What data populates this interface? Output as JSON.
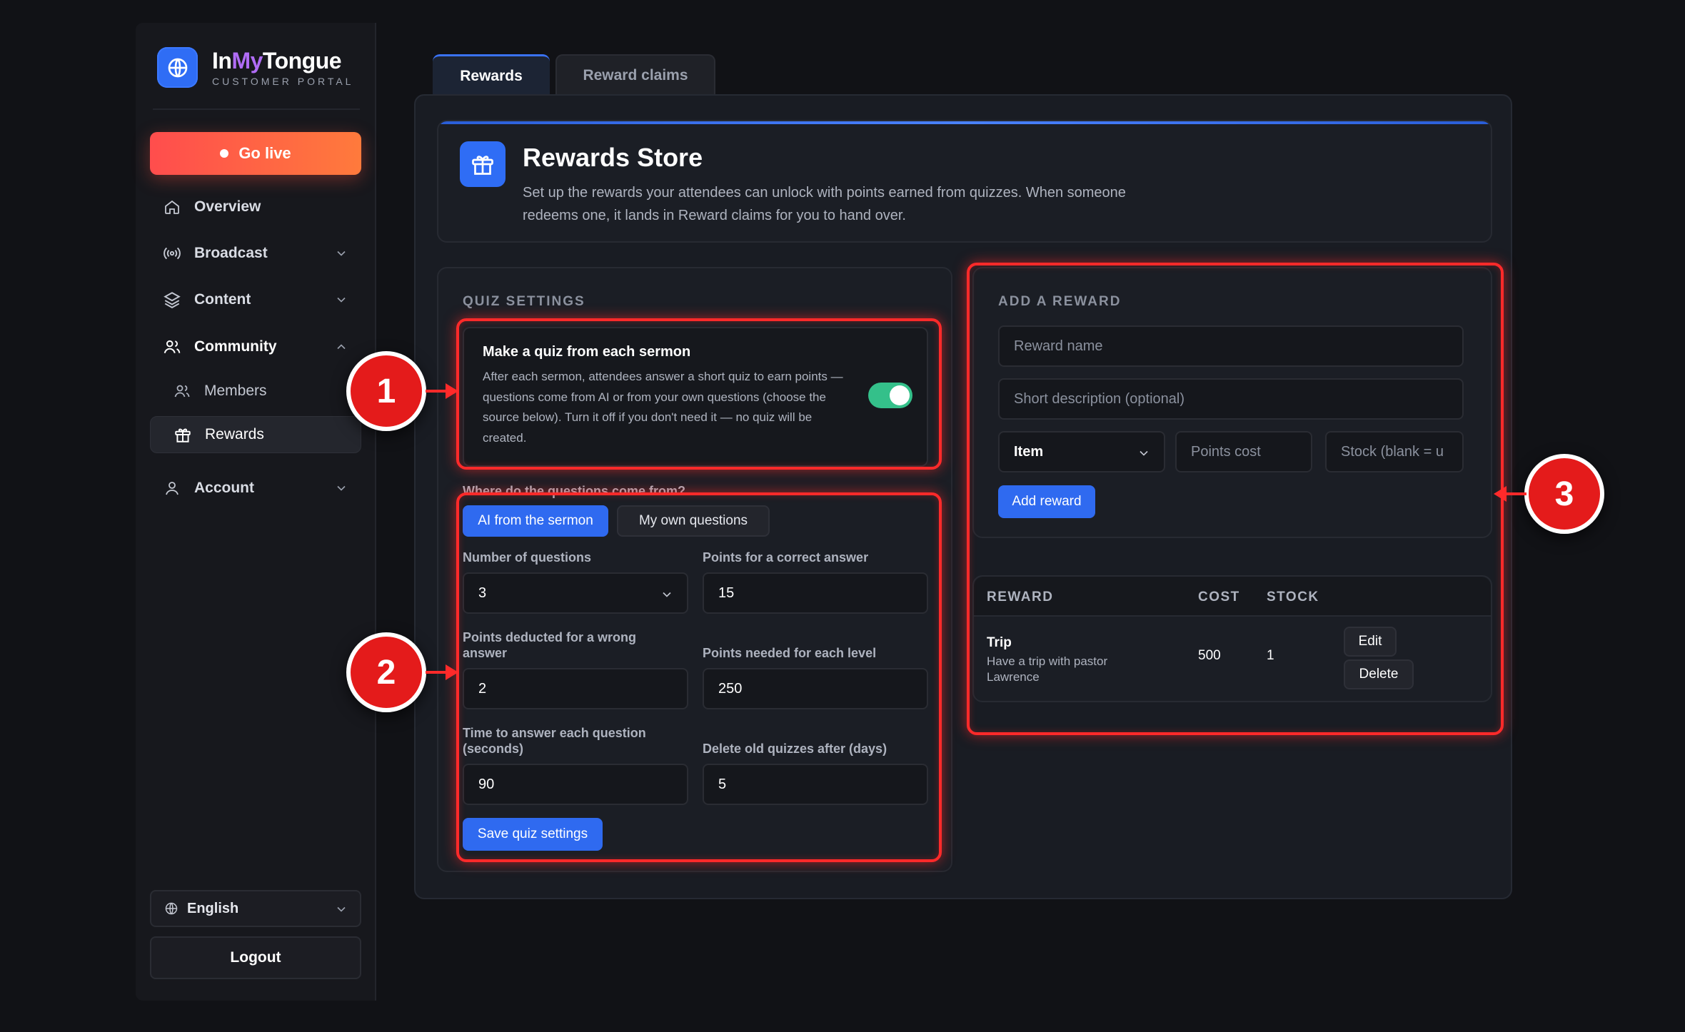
{
  "brand": {
    "name_part1": "In",
    "name_part2": "My",
    "name_part3": "Tongue",
    "subtitle": "CUSTOMER PORTAL",
    "logo_icon": "globe-icon"
  },
  "sidebar": {
    "go_live": "Go live",
    "items": [
      {
        "label": "Overview",
        "icon": "home-icon"
      },
      {
        "label": "Broadcast",
        "icon": "broadcast-icon",
        "chevron": "down"
      },
      {
        "label": "Content",
        "icon": "layers-icon",
        "chevron": "down"
      },
      {
        "label": "Community",
        "icon": "users-icon",
        "chevron": "up"
      },
      {
        "label": "Members",
        "icon": "users-icon",
        "sub": true
      },
      {
        "label": "Rewards",
        "icon": "gift-icon",
        "sub": true,
        "active": true
      },
      {
        "label": "Account",
        "icon": "user-icon",
        "chevron": "down"
      }
    ],
    "language": "English",
    "logout": "Logout"
  },
  "tabs": [
    {
      "label": "Rewards",
      "active": true
    },
    {
      "label": "Reward claims",
      "active": false
    }
  ],
  "header": {
    "title": "Rewards Store",
    "description": "Set up the rewards your attendees can unlock with points earned from quizzes. When someone redeems one, it lands in Reward claims for you to hand over."
  },
  "quiz": {
    "section_title": "QUIZ SETTINGS",
    "toggle_title": "Make a quiz from each sermon",
    "toggle_desc": "After each sermon, attendees answer a short quiz to earn points — questions come from AI or from your own questions (choose the source below). Turn it off if you don't need it — no quiz will be created.",
    "toggle_on": true,
    "source_label": "Where do the questions come from?",
    "source_options": [
      "AI from the sermon",
      "My own questions"
    ],
    "source_selected": "AI from the sermon",
    "fields": {
      "num_questions": {
        "label": "Number of questions",
        "value": "3"
      },
      "points_correct": {
        "label": "Points for a correct answer",
        "value": "15"
      },
      "points_wrong": {
        "label": "Points deducted for a wrong answer",
        "value": "2"
      },
      "points_level": {
        "label": "Points needed for each level",
        "value": "250"
      },
      "time_answer": {
        "label": "Time to answer each question (seconds)",
        "value": "90"
      },
      "delete_days": {
        "label": "Delete old quizzes after (days)",
        "value": "5"
      }
    },
    "save_label": "Save quiz settings"
  },
  "add_reward": {
    "section_title": "ADD A REWARD",
    "name_placeholder": "Reward name",
    "desc_placeholder": "Short description (optional)",
    "type_value": "Item",
    "cost_placeholder": "Points cost",
    "stock_placeholder": "Stock (blank = u",
    "add_label": "Add reward"
  },
  "rewards_table": {
    "headers": [
      "REWARD",
      "COST",
      "STOCK"
    ],
    "rows": [
      {
        "title": "Trip",
        "subtitle": "Have a trip with pastor Lawrence",
        "cost": "500",
        "stock": "1",
        "edit": "Edit",
        "delete": "Delete"
      }
    ]
  },
  "annotations": [
    {
      "number": "1"
    },
    {
      "number": "2"
    },
    {
      "number": "3"
    }
  ],
  "colors": {
    "accent": "#2f6af0",
    "live": "#ff5a45",
    "toggle_on": "#34c08a",
    "highlight": "#ff2a2a",
    "brand_purple": "#b06cf5"
  }
}
